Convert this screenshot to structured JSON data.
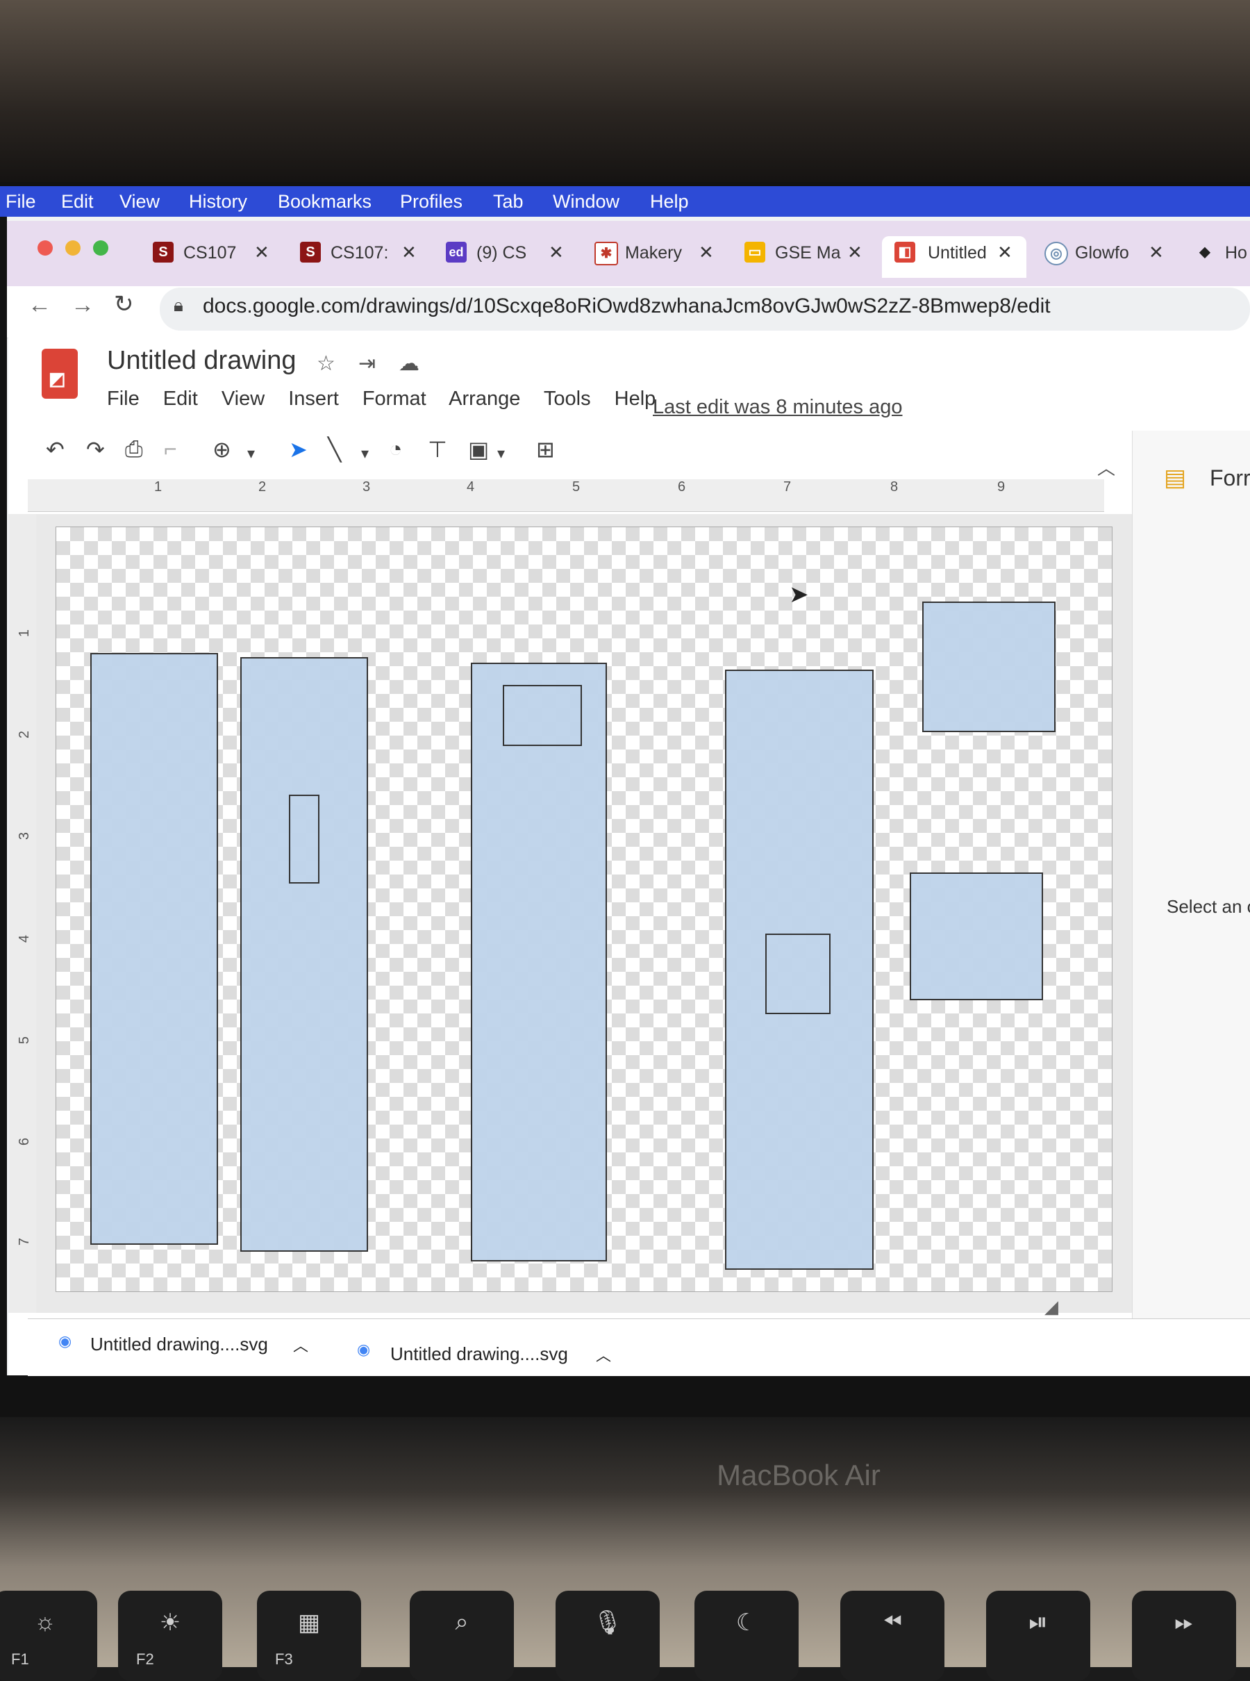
{
  "mac_menu": [
    "File",
    "Edit",
    "View",
    "History",
    "Bookmarks",
    "Profiles",
    "Tab",
    "Window",
    "Help"
  ],
  "tabs": [
    {
      "title": "CS107",
      "icon": "stanford-icon",
      "color": "#8c1515"
    },
    {
      "title": "CS107:",
      "icon": "stanford-icon",
      "color": "#8c1515"
    },
    {
      "title": "(9) CS",
      "icon": "ed-icon",
      "color": "#5b3cc4"
    },
    {
      "title": "Makery",
      "icon": "makery-icon",
      "color": "#c0392b"
    },
    {
      "title": "GSE Ma",
      "icon": "slides-icon",
      "color": "#f4b400"
    },
    {
      "title": "Untitled",
      "icon": "drawings-icon",
      "color": "#db4437",
      "active": true
    },
    {
      "title": "Glowfo",
      "icon": "glowforge-icon",
      "color": "#6f8fb3"
    },
    {
      "title": "Ho",
      "icon": "hackster-icon",
      "color": "#222222"
    }
  ],
  "tab_favicon_letters": {
    "stanford": "S",
    "ed": "ed"
  },
  "url": "docs.google.com/drawings/d/10Scxqe8oRiOwd8zwhanaJcm8ovGJw0wS2zZ-8Bmwep8/edit",
  "doc": {
    "title": "Untitled drawing",
    "menu": [
      "File",
      "Edit",
      "View",
      "Insert",
      "Format",
      "Arrange",
      "Tools",
      "Help"
    ],
    "last_edit": "Last edit was 8 minutes ago"
  },
  "ruler_numbers": [
    "1",
    "2",
    "3",
    "4",
    "5",
    "6",
    "7",
    "8",
    "9"
  ],
  "vruler_numbers": [
    "1",
    "2",
    "3",
    "4",
    "5",
    "6",
    "7"
  ],
  "side_panel": {
    "title": "Forr",
    "hint": "Select an o"
  },
  "downloads": [
    "Untitled drawing....svg",
    "Untitled drawing....svg"
  ],
  "device_label": "MacBook Air",
  "fn_keys": [
    "F1",
    "F2",
    "F3"
  ],
  "colors": {
    "mac_menubar": "#2d4bd6",
    "shape_fill": "#bed3ea",
    "tab_strip": "#e8dcef"
  }
}
